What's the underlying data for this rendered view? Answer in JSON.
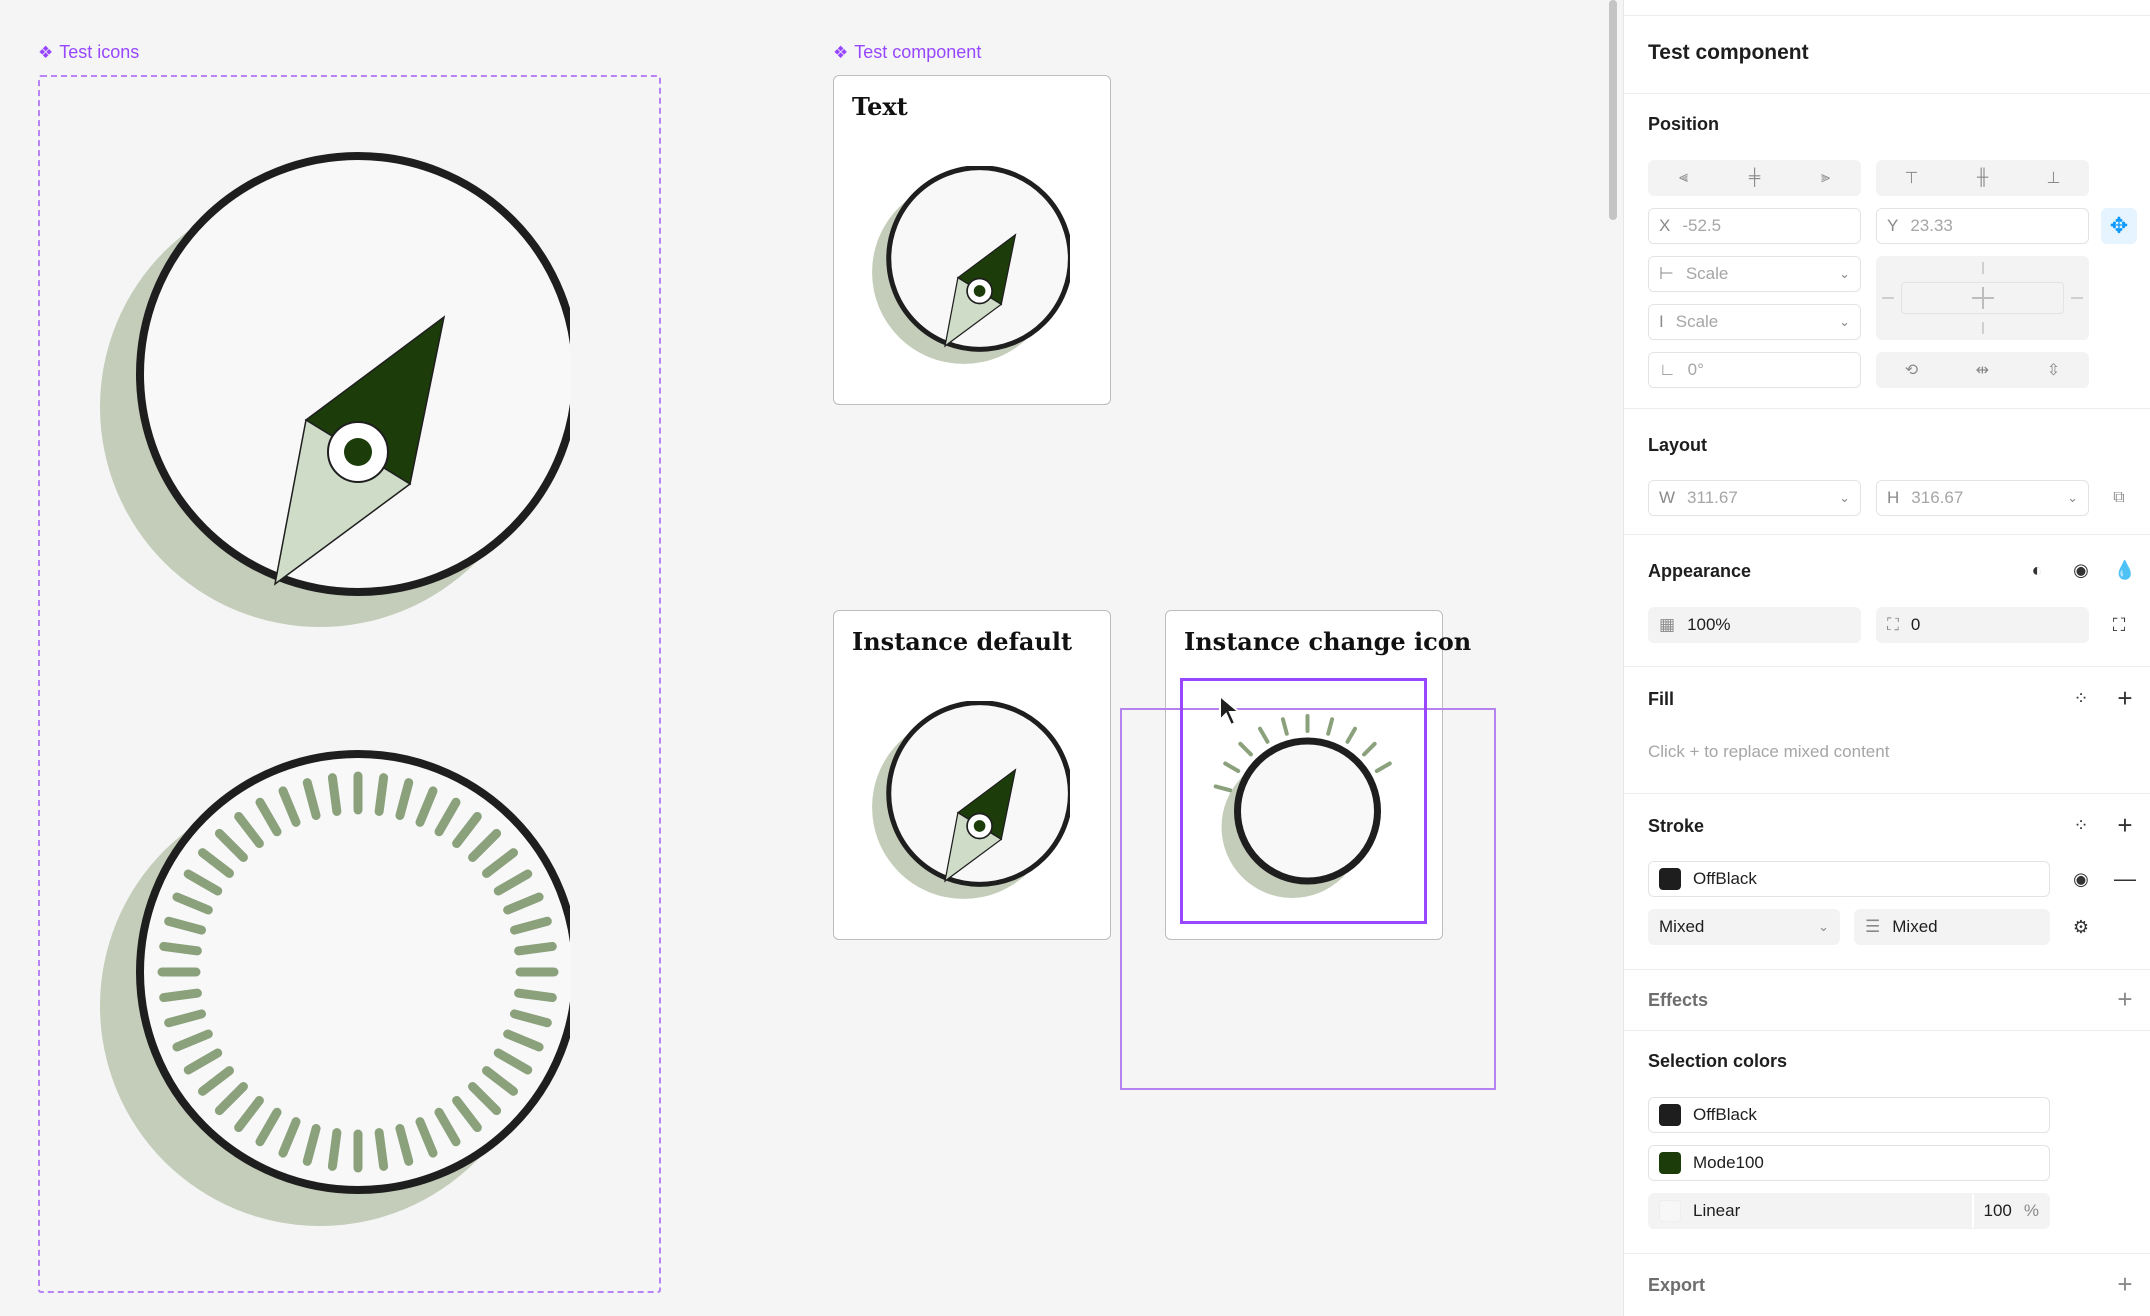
{
  "canvas": {
    "frame_test_icons": {
      "label": "Test icons"
    },
    "frame_test_component": {
      "label": "Test component"
    },
    "cards": [
      {
        "title": "Text"
      },
      {
        "title": "Instance default"
      },
      {
        "title": "Instance change icon"
      }
    ]
  },
  "panel": {
    "title": "Test component",
    "position": {
      "heading": "Position",
      "x_label": "X",
      "x_value": "-52.5",
      "y_label": "Y",
      "y_value": "23.33",
      "h_constraint": "Scale",
      "v_constraint": "Scale",
      "rotation": "0°"
    },
    "layout": {
      "heading": "Layout",
      "w_label": "W",
      "w_value": "311.67",
      "h_label": "H",
      "h_value": "316.67"
    },
    "appearance": {
      "heading": "Appearance",
      "opacity": "100%",
      "radius": "0"
    },
    "fill": {
      "heading": "Fill",
      "hint": "Click + to replace mixed content"
    },
    "stroke": {
      "heading": "Stroke",
      "color_name": "OffBlack",
      "position": "Mixed",
      "weight": "Mixed"
    },
    "effects": {
      "heading": "Effects"
    },
    "selection_colors": {
      "heading": "Selection colors",
      "items": [
        {
          "name": "OffBlack",
          "color": "#1e1e1e"
        },
        {
          "name": "Mode100",
          "color": "#1c3d0a"
        },
        {
          "name": "Linear",
          "value": "100",
          "unit": "%"
        }
      ]
    },
    "export": {
      "heading": "Export"
    }
  },
  "colors": {
    "accent": "#9747ff",
    "compass_dark": "#1c3d0a",
    "compass_light": "#cfdcc8",
    "shadow": "#c3cdb9",
    "tick": "#8aa17c"
  }
}
